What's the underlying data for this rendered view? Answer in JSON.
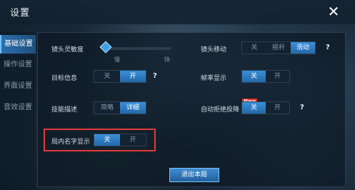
{
  "header": {
    "title": "设置",
    "close_icon": "close-icon"
  },
  "sidebar": {
    "items": [
      {
        "label": "基础设置",
        "active": true
      },
      {
        "label": "操作设置",
        "active": false
      },
      {
        "label": "界面设置",
        "active": false
      },
      {
        "label": "音效设置",
        "active": false
      }
    ]
  },
  "settings": {
    "camera_sensitivity": {
      "label": "镜头灵敏度",
      "min_label": "慢",
      "max_label": "快",
      "value": 0.03
    },
    "camera_move": {
      "label": "镜头移动",
      "options": [
        "关",
        "摇杆",
        "滑动"
      ],
      "selected": "滑动"
    },
    "target_info": {
      "label": "目标信息",
      "options": [
        "关",
        "开"
      ],
      "selected": "开"
    },
    "fps_display": {
      "label": "帧率显示",
      "options": [
        "关",
        "开"
      ],
      "selected": "关"
    },
    "skill_desc": {
      "label": "技能描述",
      "options": [
        "简略",
        "详细"
      ],
      "selected": "详细"
    },
    "auto_reject_surrender": {
      "label": "自动拒绝投降",
      "badge": "New",
      "options": [
        "关",
        "开"
      ],
      "selected": "关"
    },
    "in_game_names": {
      "label": "局内名字显示",
      "options": [
        "关",
        "开"
      ],
      "selected": "关"
    }
  },
  "help_glyph": "?",
  "footer": {
    "exit_label": "退出本局"
  },
  "colors": {
    "accent": "#2f7fc4",
    "highlight": "#e23a3a",
    "badge": "#d7332c"
  }
}
